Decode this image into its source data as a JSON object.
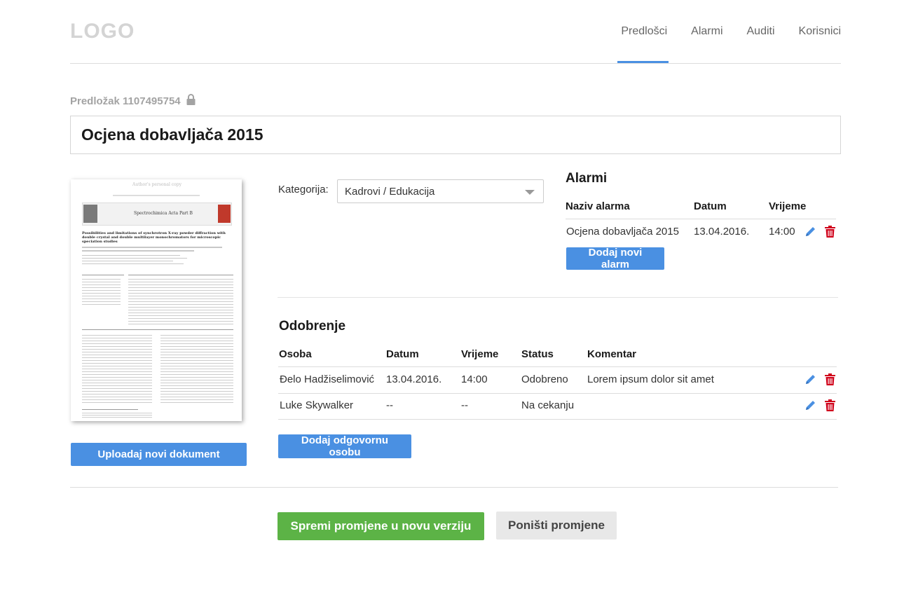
{
  "header": {
    "logo": "LOGO",
    "nav": [
      {
        "label": "Predlošci",
        "active": true
      },
      {
        "label": "Alarmi",
        "active": false
      },
      {
        "label": "Auditi",
        "active": false
      },
      {
        "label": "Korisnici",
        "active": false
      }
    ],
    "accent_color": "#4a90e2"
  },
  "template": {
    "id_label": "Predložak 1107495754",
    "title": "Ocjena dobavljača 2015"
  },
  "document": {
    "header_note": "Author's personal copy",
    "journal": "Spectrochimica Acta Part B",
    "article_title": "Possibilities and limitations of synchrotron X-ray powder diffraction with double crystal and double multilayer monochromators for microscopic speciation studies",
    "upload_label": "Uploadaj novi dokument"
  },
  "category": {
    "label": "Kategorija:",
    "value": "Kadrovi / Edukacija"
  },
  "alarms": {
    "title": "Alarmi",
    "columns": [
      "Naziv alarma",
      "Datum",
      "Vrijeme"
    ],
    "rows": [
      {
        "name": "Ocjena dobavljača 2015",
        "date": "13.04.2016.",
        "time": "14:00"
      }
    ],
    "add_label": "Dodaj novi alarm"
  },
  "approval": {
    "title": "Odobrenje",
    "columns": [
      "Osoba",
      "Datum",
      "Vrijeme",
      "Status",
      "Komentar"
    ],
    "rows": [
      {
        "person": "Đelo Hadžiselimović",
        "date": "13.04.2016.",
        "time": "14:00",
        "status": "Odobreno",
        "comment": "Lorem ipsum dolor sit amet"
      },
      {
        "person": "Luke Skywalker",
        "date": "--",
        "time": "--",
        "status": "Na cekanju",
        "comment": ""
      }
    ],
    "add_label": "Dodaj odgovornu osobu"
  },
  "footer": {
    "save_label": "Spremi promjene u novu verziju",
    "cancel_label": "Poništi promjene",
    "save_color": "#5cb346"
  },
  "icons": {
    "edit": "pencil-icon",
    "delete": "trash-icon",
    "lock": "lock-icon",
    "edit_color": "#4a90e2",
    "delete_color": "#d0021b"
  }
}
